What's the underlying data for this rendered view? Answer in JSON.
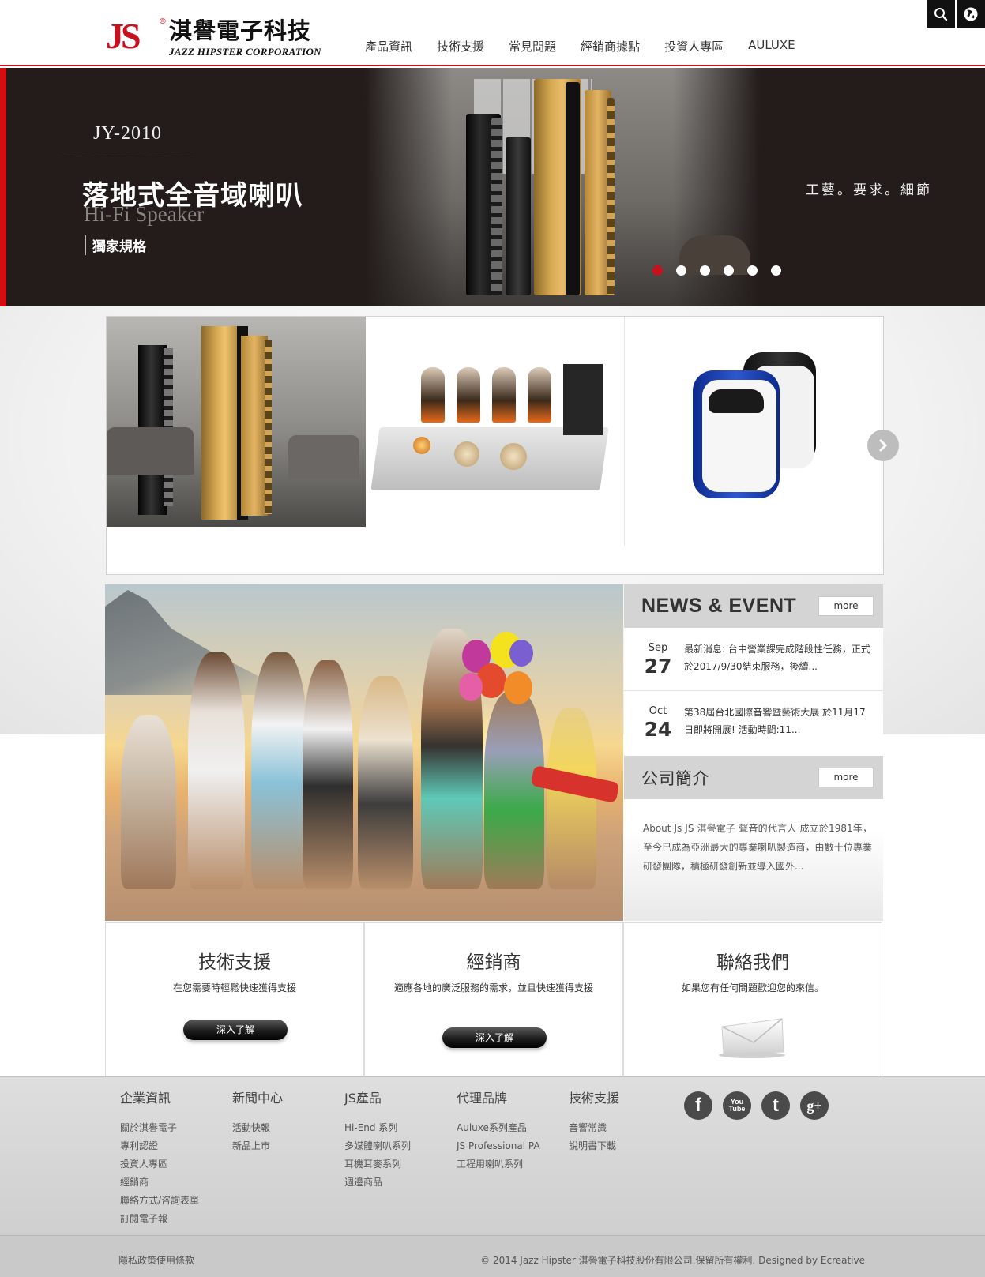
{
  "brand": {
    "logo_mark": "JS",
    "name_cn": "淇譽電子科技",
    "name_en": "JAZZ HIPSTER CORPORATION",
    "accent_color": "#c8101f"
  },
  "nav": {
    "items": [
      {
        "label": "產品資訊"
      },
      {
        "label": "技術支援"
      },
      {
        "label": "常見問題"
      },
      {
        "label": "經銷商據點"
      },
      {
        "label": "投資人專區"
      },
      {
        "label": "AULUXE"
      }
    ]
  },
  "top_icons": {
    "search": "search-icon",
    "language": "globe-icon"
  },
  "hero": {
    "model": "JY-2010",
    "headline": "落地式全音域喇叭",
    "subtitle": "Hi-Fi Speaker",
    "tag": "獨家規格",
    "motto": "工藝。要求。細節",
    "slides_total": 6,
    "active_slide": 1
  },
  "products": {
    "items": [
      {
        "name": "floor-speakers"
      },
      {
        "name": "tube-amplifier"
      },
      {
        "name": "portable-voice-amplifier"
      }
    ],
    "next_icon": "chevron-right-icon"
  },
  "news": {
    "title": "NEWS & EVENT",
    "more": "more",
    "items": [
      {
        "month": "Sep",
        "day": "27",
        "text": "最新消息: 台中營業課完成階段性任務，正式於2017/9/30結束服務，後續..."
      },
      {
        "month": "Oct",
        "day": "24",
        "text": "第38屆台北國際音響暨藝術大展 於11月17日即將開展! 活動時間:11..."
      }
    ]
  },
  "about": {
    "title": "公司簡介",
    "more": "more",
    "body": "About Js JS 淇譽電子 聲音的代言人 成立於1981年，至今已成為亞洲最大的專業喇叭製造商，由數十位專業研發團隊，積極研發創新並導入國外..."
  },
  "boxes": [
    {
      "title": "技術支援",
      "desc": "在您需要時輕鬆快速獲得支援",
      "button": "深入了解"
    },
    {
      "title": "經銷商",
      "desc": "適應各地的廣泛服務的需求，並且快速獲得支援",
      "button": "深入了解"
    },
    {
      "title": "聯絡我們",
      "desc": "如果您有任何問題歡迎您的來信。",
      "icon": "envelope-icon"
    }
  ],
  "footer": {
    "columns": [
      {
        "heading": "企業資訊",
        "links": [
          "關於淇譽電子",
          "專利認證",
          "投資人專區",
          "經銷商",
          "聯絡方式/咨詢表單",
          "訂閱電子報"
        ]
      },
      {
        "heading": "新聞中心",
        "links": [
          "活動快報",
          "新品上市"
        ]
      },
      {
        "heading": "JS產品",
        "links": [
          "Hi-End 系列",
          "多媒體喇叭系列",
          "耳機耳麥系列",
          "週邊商品"
        ]
      },
      {
        "heading": "代理品牌",
        "links": [
          "Auluxe系列產品",
          "JS Professional PA",
          "工程用喇叭系列"
        ]
      },
      {
        "heading": "技術支援",
        "links": [
          "音響常識",
          "說明書下載"
        ]
      }
    ],
    "social": [
      {
        "name": "facebook-icon",
        "glyph": "f"
      },
      {
        "name": "youtube-icon",
        "glyph": "You Tube"
      },
      {
        "name": "twitter-icon",
        "glyph": "t"
      },
      {
        "name": "googleplus-icon",
        "glyph": "g+"
      }
    ],
    "policy": "隱私政策使用條款",
    "copyright": "© 2014 Jazz Hipster 淇譽電子科技股份有限公司.保留所有權利. Designed by Ecreative"
  }
}
